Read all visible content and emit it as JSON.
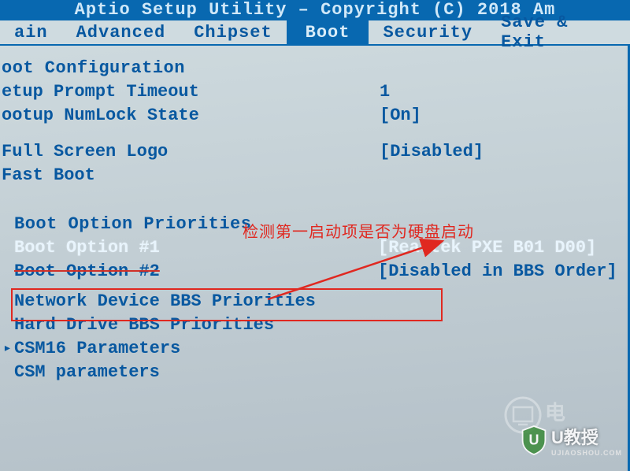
{
  "title": "Aptio Setup Utility – Copyright (C) 2018 Am",
  "menu": {
    "items": [
      "ain",
      "Advanced",
      "Chipset",
      "Boot",
      "Security",
      "Save & Exit"
    ],
    "active_index": 3
  },
  "sections": {
    "boot_config_header": "oot Configuration",
    "setup_prompt": {
      "label": "etup Prompt Timeout",
      "value": "1"
    },
    "numlock": {
      "label": "ootup NumLock State",
      "value": "[On]"
    },
    "fullscreen_logo": {
      "label": "Full Screen Logo",
      "value": "[Disabled]"
    },
    "fast_boot": {
      "label": "Fast Boot",
      "value": ""
    },
    "priorities_header": "Boot Option Priorities",
    "boot_option_1": {
      "label": "Boot Option #1",
      "value": "[Realtek PXE B01 D00]"
    },
    "boot_option_2": {
      "label": "Boot Option #2",
      "value": "[Disabled in BBS Order]"
    },
    "network_bbs": "Network Device BBS Priorities",
    "harddrive_bbs": "Hard Drive BBS Priorities",
    "csm16": "CSM16 Parameters",
    "csm": "CSM parameters"
  },
  "annotation": {
    "text": "检测第一启动项是否为硬盘启动"
  },
  "watermarks": {
    "wm1_text": "电",
    "wm2_brand": "U教授",
    "wm2_sub": "UJIAOSHOU.COM"
  }
}
